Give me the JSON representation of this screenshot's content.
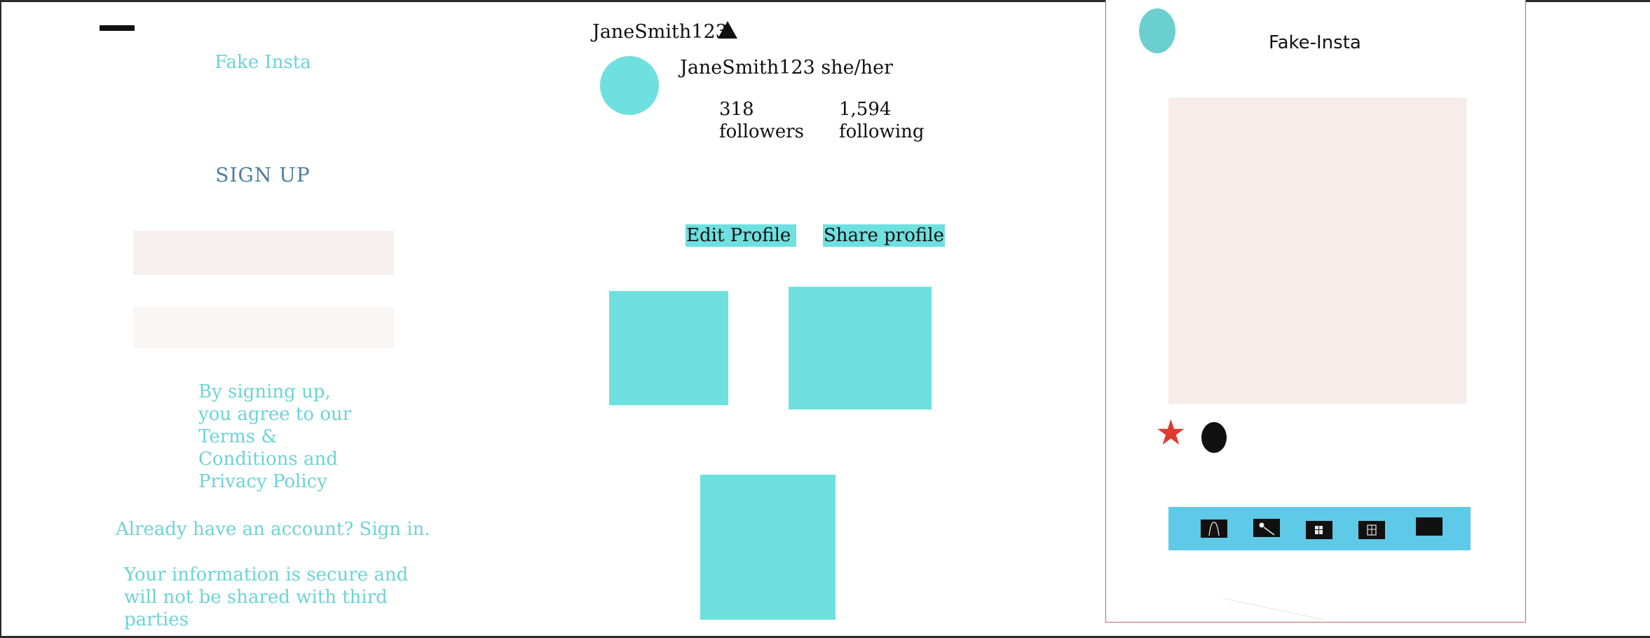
{
  "signup": {
    "brand": "Fake Insta",
    "title": "SIGN UP",
    "terms": "By signing up, you agree to our Terms & Conditions and Privacy Policy",
    "signin_link": "Already have an account? Sign in.",
    "secure_note": "Your information is secure and will not be shared with third parties"
  },
  "profile": {
    "username": "JaneSmith123",
    "display_name": "JaneSmith123 she/her",
    "followers_count": "318",
    "followers_label": "followers",
    "following_count": "1,594",
    "following_label": "following",
    "edit_label": "Edit Profile",
    "share_label": "Share profile"
  },
  "feed": {
    "title": "Fake-Insta"
  },
  "colors": {
    "accent": "#6ee0e0",
    "nav_bar": "#5fc9e8",
    "text_link": "#6cd3d6",
    "star": "#e03a2f",
    "image_placeholder": "#f7ecea"
  },
  "icons": {
    "menu": "menu-icon",
    "caret": "caret-up-icon",
    "like": "star-icon",
    "comment": "comment-icon",
    "nav": [
      "home-icon",
      "search-icon",
      "grid-icon",
      "reels-icon",
      "profile-icon"
    ]
  }
}
